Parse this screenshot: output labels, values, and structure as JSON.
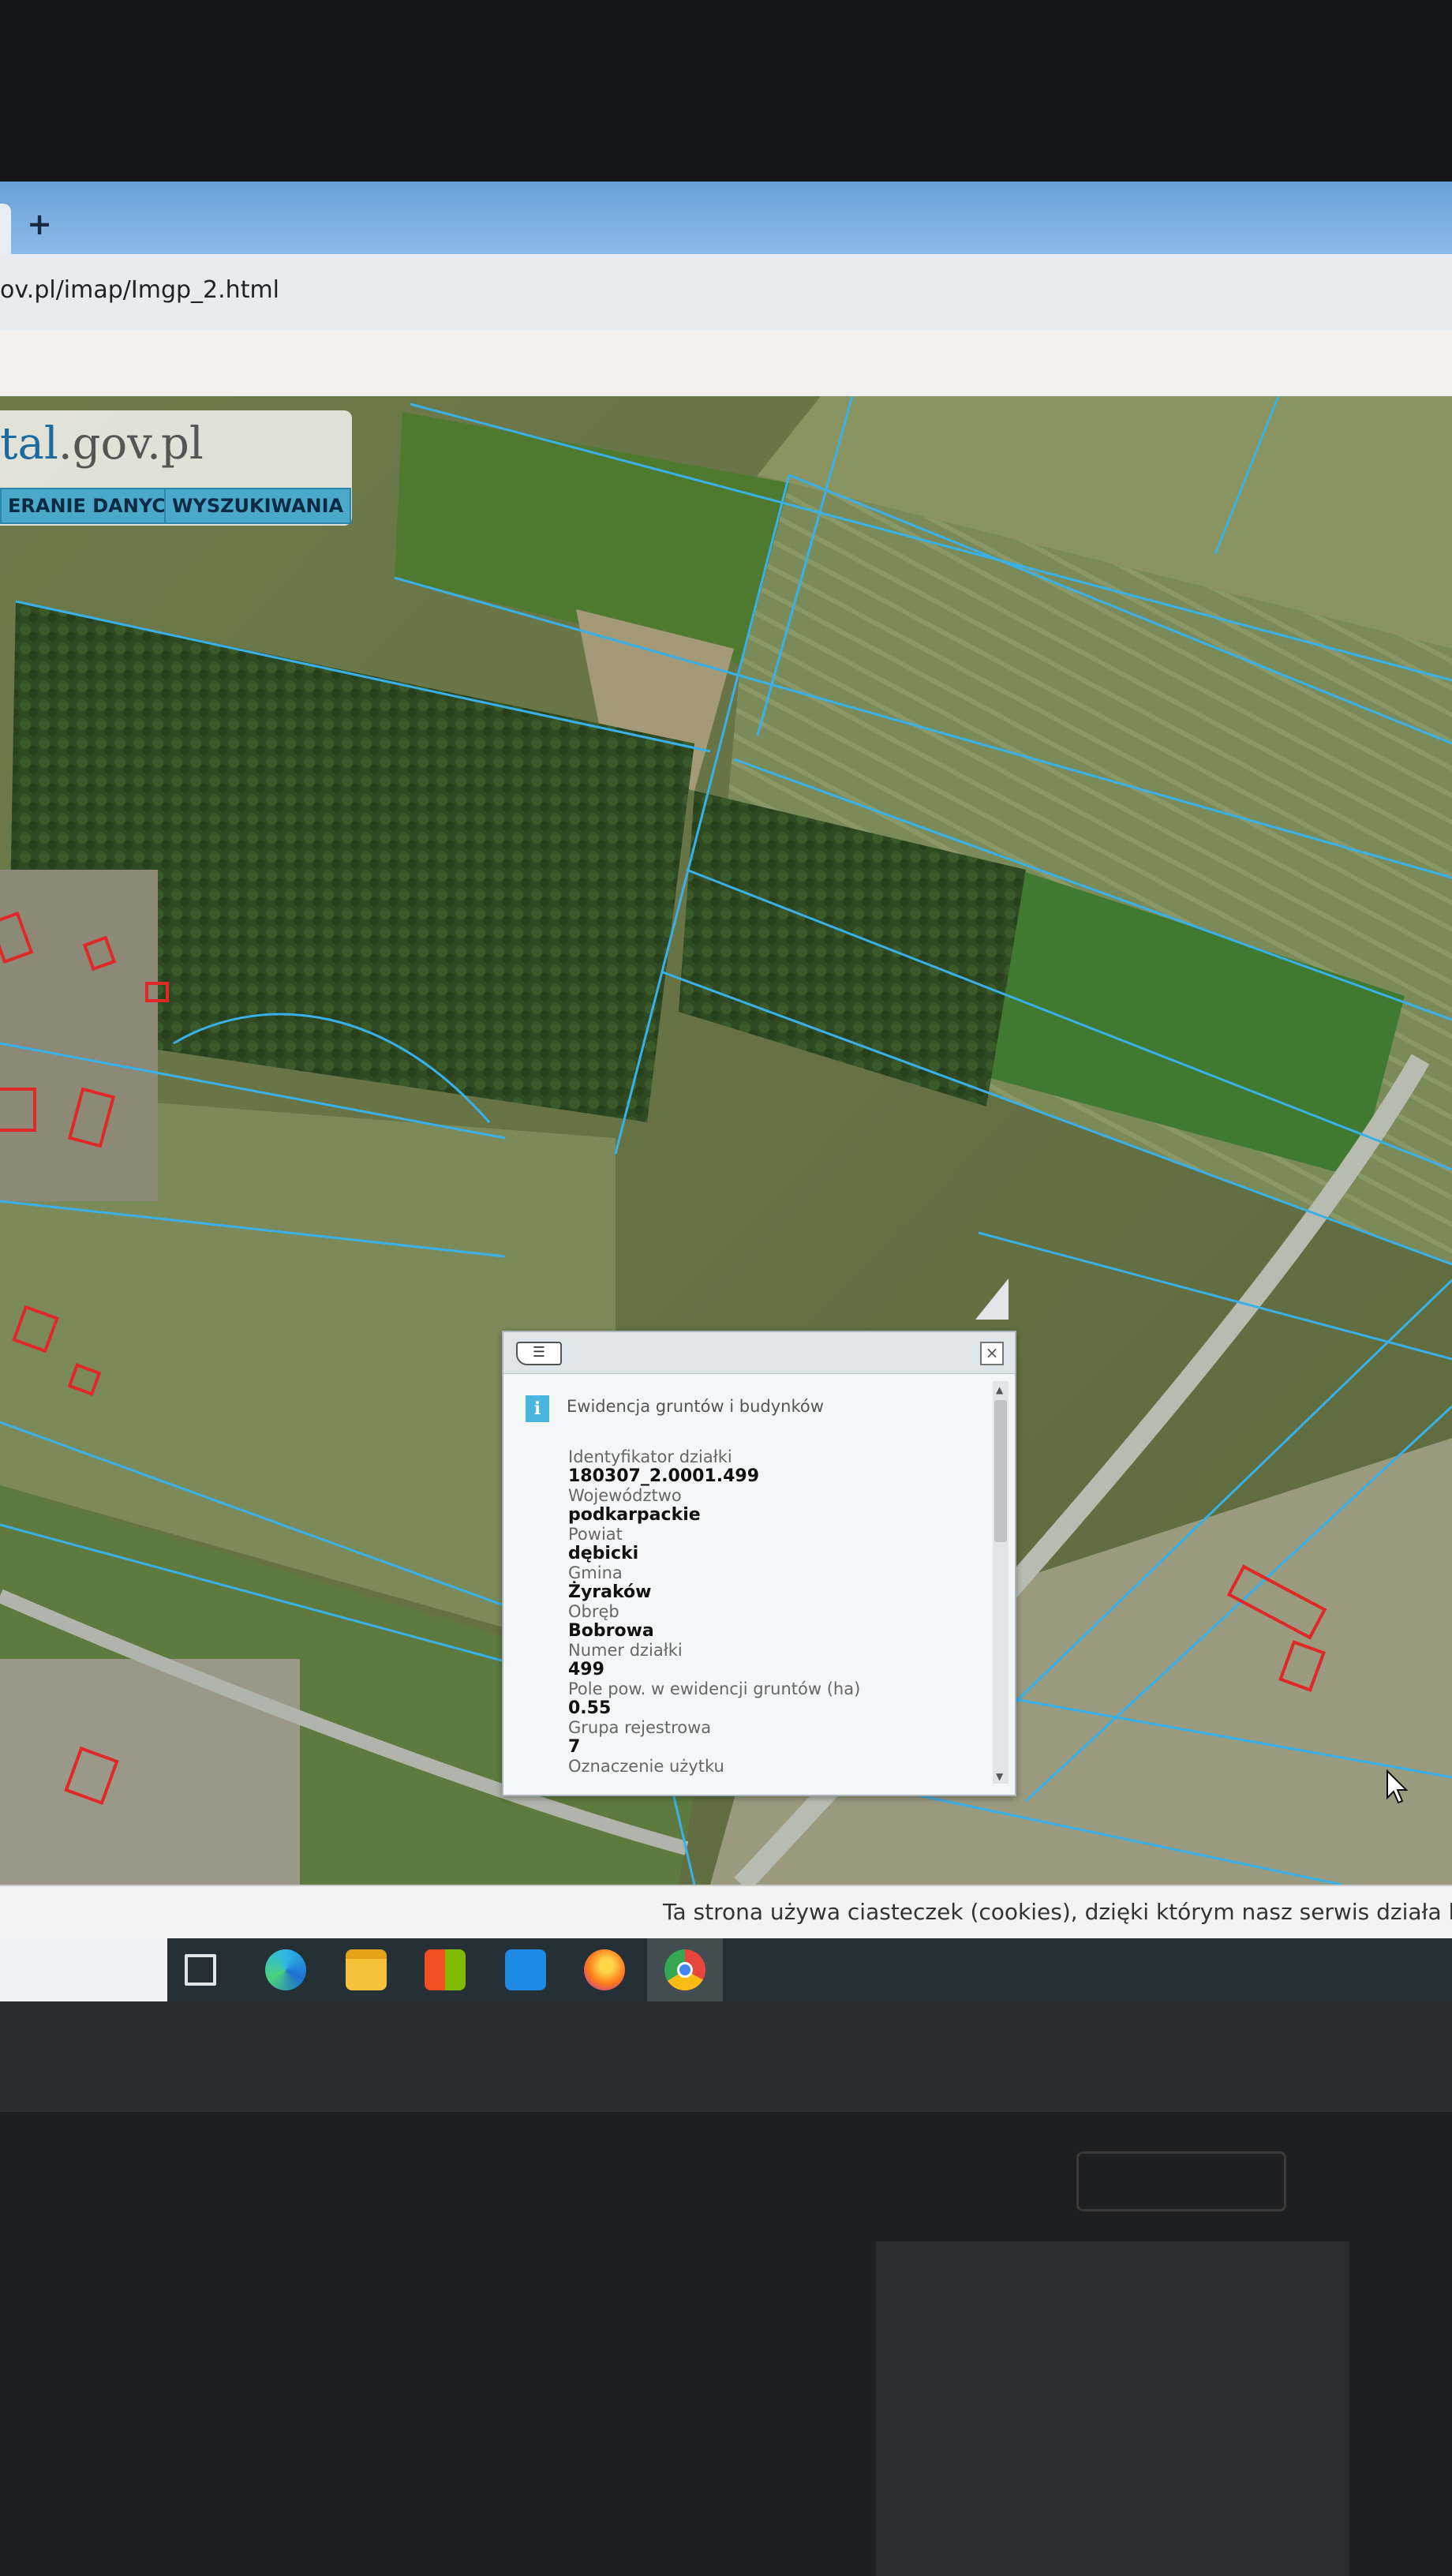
{
  "browser": {
    "new_tab": "+",
    "url": "ov.pl/imap/Imgp_2.html"
  },
  "site": {
    "logo_prefix": "tal",
    "logo_suffix": ".gov.pl",
    "buttons": [
      "ERANIE DANYCH",
      "WYSZUKIWANIA"
    ]
  },
  "popup": {
    "title": "Ewidencja gruntów i budynków",
    "fields": [
      {
        "label": "Identyfikator działki",
        "value": "180307_2.0001.499"
      },
      {
        "label": "Województwo",
        "value": "podkarpackie"
      },
      {
        "label": "Powiat",
        "value": "dębicki"
      },
      {
        "label": "Gmina",
        "value": "Żyraków"
      },
      {
        "label": "Obręb",
        "value": "Bobrowa"
      },
      {
        "label": "Numer działki",
        "value": "499"
      },
      {
        "label": "Pole pow. w ewidencji gruntów (ha)",
        "value": "0.55"
      },
      {
        "label": "Grupa rejestrowa",
        "value": "7"
      },
      {
        "label": "Oznaczenie użytku",
        "value": ""
      }
    ]
  },
  "cookie_bar": {
    "text": "Ta strona używa ciasteczek (cookies), dzięki którym nasz serwis działa lep"
  },
  "taskbar": {
    "icons": [
      "task-view-icon",
      "edge-icon",
      "file-explorer-icon",
      "store-icon",
      "mail-icon",
      "firefox-icon",
      "chrome-icon"
    ]
  },
  "colors": {
    "parcel_line": "#3ab0e8",
    "building_outline": "#e02828",
    "button_bg": "#4aa8c8"
  }
}
